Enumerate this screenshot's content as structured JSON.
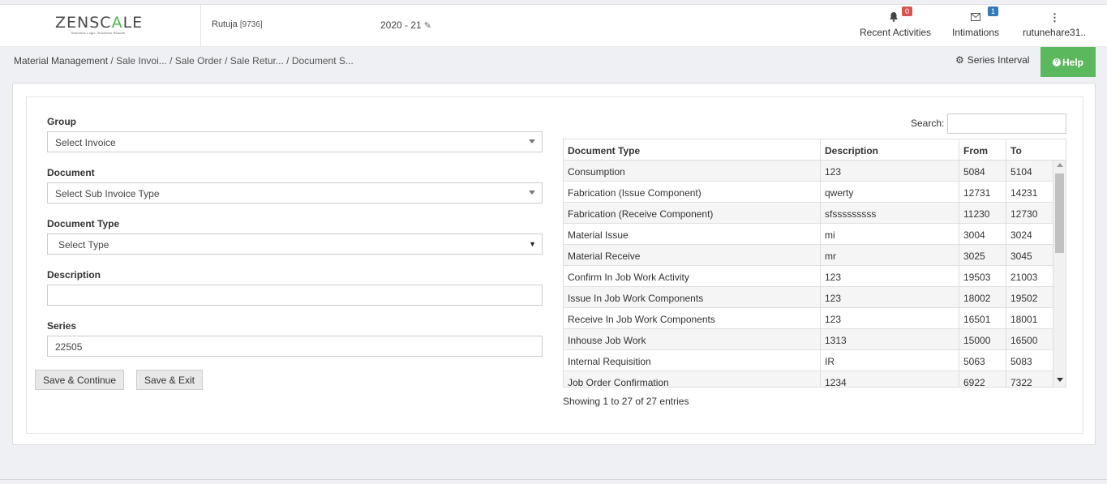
{
  "header": {
    "logo_main": "ZENSC",
    "logo_accent": "A",
    "logo_end": "LE",
    "logo_tagline": "Business Logic, Business Results",
    "user_name": "Rutuja",
    "user_id": "[9736]",
    "fiscal_year": "2020 - 21",
    "nav": {
      "recent_activities": {
        "label": "Recent Activities",
        "badge": "0"
      },
      "intimations": {
        "label": "Intimations",
        "badge": "1"
      },
      "account": {
        "label": "rutunehare31.."
      }
    }
  },
  "breadcrumb": {
    "root": "Material Management",
    "trail": " / Sale Invoi... / Sale Order / Sale Retur... / Document S..."
  },
  "actions": {
    "series_interval": "Series Interval",
    "help": "Help"
  },
  "form": {
    "group": {
      "label": "Group",
      "value": "Select Invoice"
    },
    "document": {
      "label": "Document",
      "value": "Select Sub Invoice Type"
    },
    "document_type": {
      "label": "Document Type",
      "value": "Select Type"
    },
    "description": {
      "label": "Description",
      "value": ""
    },
    "series": {
      "label": "Series",
      "value": "22505"
    },
    "save_continue": "Save & Continue",
    "save_exit": "Save & Exit"
  },
  "table": {
    "search_label": "Search:",
    "columns": [
      "Document Type",
      "Description",
      "From",
      "To"
    ],
    "rows": [
      [
        "Consumption",
        "123",
        "5084",
        "5104"
      ],
      [
        "Fabrication (Issue Component)",
        "qwerty",
        "12731",
        "14231"
      ],
      [
        "Fabrication (Receive Component)",
        "sfsssssssss",
        "11230",
        "12730"
      ],
      [
        "Material Issue",
        "mi",
        "3004",
        "3024"
      ],
      [
        "Material Receive",
        "mr",
        "3025",
        "3045"
      ],
      [
        "Confirm In Job Work Activity",
        "123",
        "19503",
        "21003"
      ],
      [
        "Issue In Job Work Components",
        "123",
        "18002",
        "19502"
      ],
      [
        "Receive In Job Work Components",
        "123",
        "16501",
        "18001"
      ],
      [
        "Inhouse Job Work",
        "1313",
        "15000",
        "16500"
      ],
      [
        "Internal Requisition",
        "IR",
        "5063",
        "5083"
      ],
      [
        "Job Order Confirmation",
        "1234",
        "6922",
        "7322"
      ]
    ],
    "entries_info": "Showing 1 to 27 of 27 entries"
  }
}
